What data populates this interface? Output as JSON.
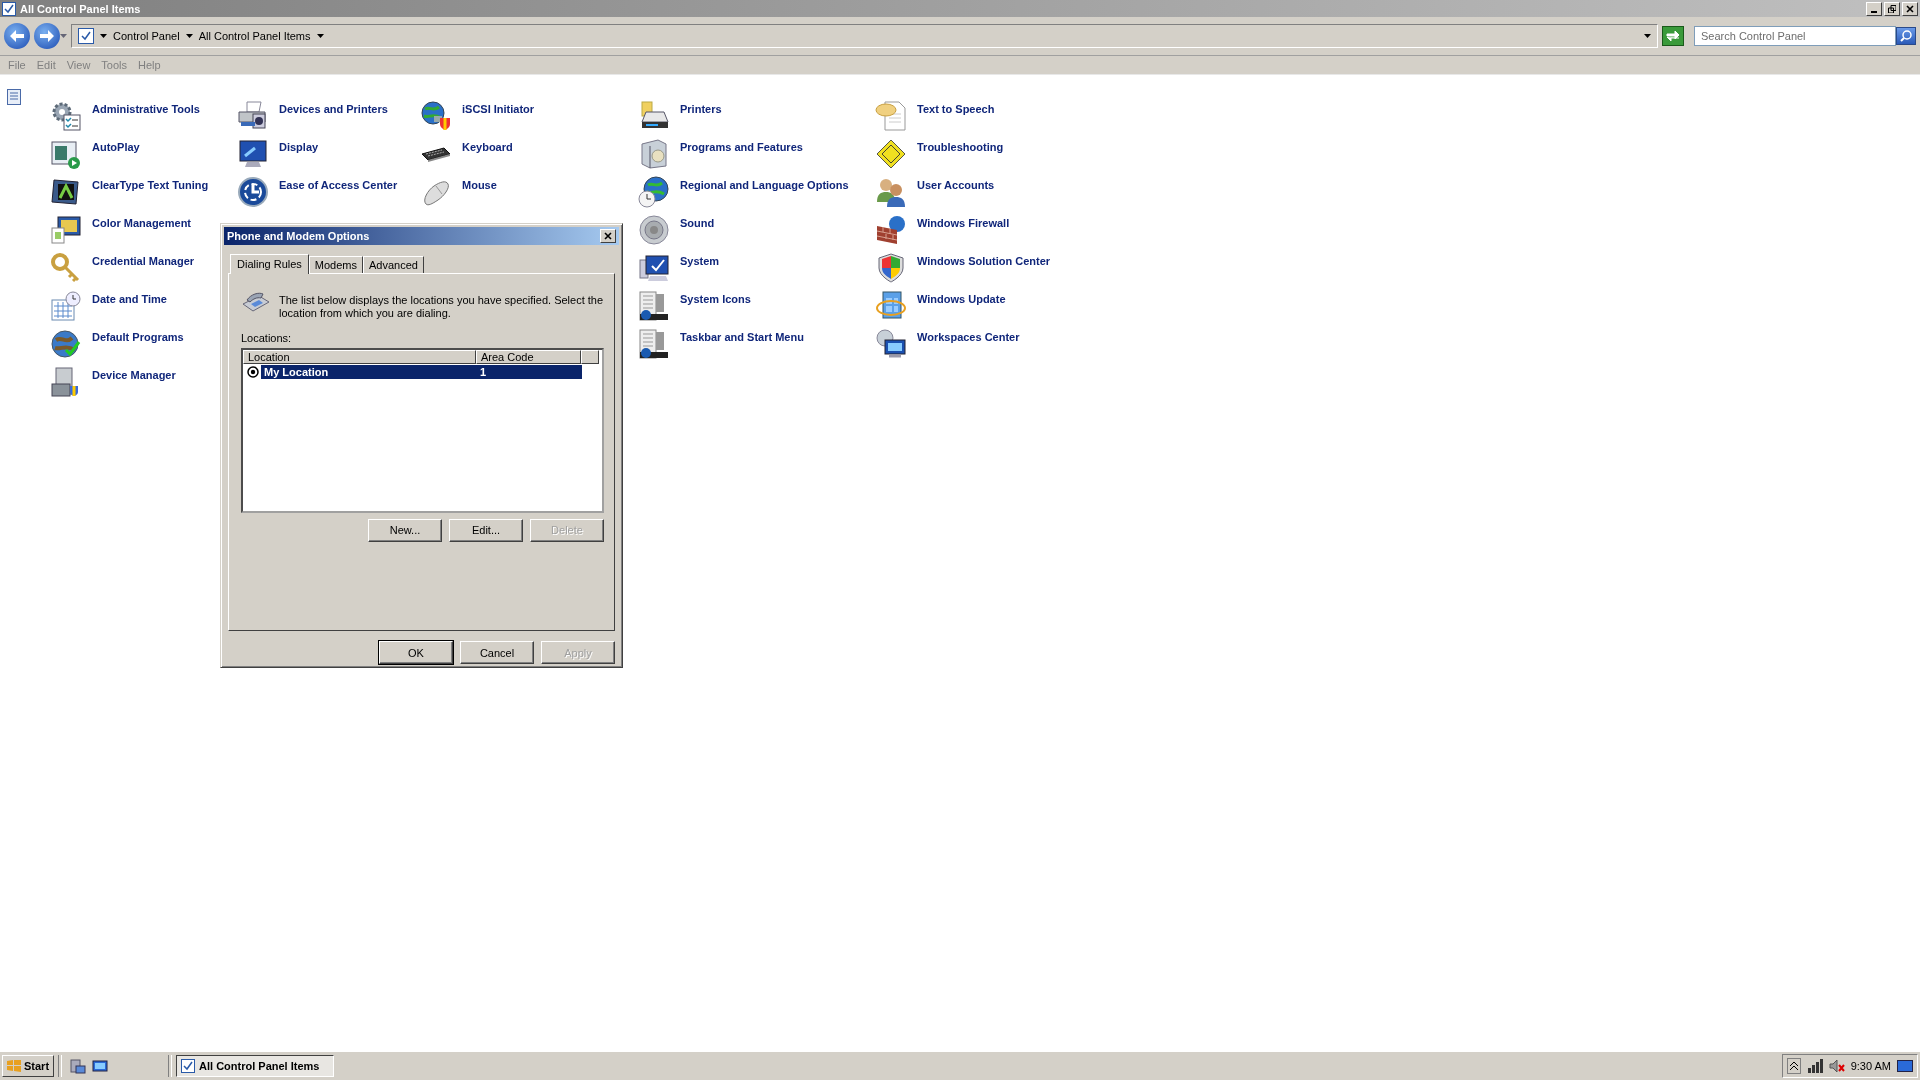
{
  "window": {
    "title": "All Control Panel Items"
  },
  "address": {
    "breadcrumbs": [
      {
        "label": "Control Panel"
      },
      {
        "label": "All Control Panel Items"
      }
    ],
    "search": {
      "placeholder": "Search Control Panel"
    }
  },
  "menu": [
    {
      "label": "File"
    },
    {
      "label": "Edit"
    },
    {
      "label": "View"
    },
    {
      "label": "Tools"
    },
    {
      "label": "Help"
    }
  ],
  "item_columns": [
    {
      "items": [
        {
          "label": "Administrative Tools"
        },
        {
          "label": "AutoPlay"
        },
        {
          "label": "ClearType Text Tuning"
        },
        {
          "label": "Color Management"
        },
        {
          "label": "Credential Manager"
        },
        {
          "label": "Date and Time"
        },
        {
          "label": "Default Programs"
        },
        {
          "label": "Device Manager"
        }
      ]
    },
    {
      "items": [
        {
          "label": "Devices and Printers"
        },
        {
          "label": "Display"
        },
        {
          "label": "Ease of Access Center"
        }
      ]
    },
    {
      "items": [
        {
          "label": "iSCSI Initiator"
        },
        {
          "label": "Keyboard"
        },
        {
          "label": "Mouse"
        }
      ]
    },
    {
      "items": [
        {
          "label": "Printers"
        },
        {
          "label": "Programs and Features"
        },
        {
          "label": "Regional and Language Options"
        },
        {
          "label": "Sound"
        },
        {
          "label": "System"
        },
        {
          "label": "System Icons"
        },
        {
          "label": "Taskbar and Start Menu"
        }
      ]
    },
    {
      "items": [
        {
          "label": "Text to Speech"
        },
        {
          "label": "Troubleshooting"
        },
        {
          "label": "User Accounts"
        },
        {
          "label": "Windows Firewall"
        },
        {
          "label": "Windows Solution Center"
        },
        {
          "label": "Windows Update"
        },
        {
          "label": "Workspaces Center"
        }
      ]
    }
  ],
  "dialog": {
    "title": "Phone and Modem Options",
    "tabs": [
      {
        "label": "Dialing Rules",
        "selected": true
      },
      {
        "label": "Modems",
        "selected": false
      },
      {
        "label": "Advanced",
        "selected": false
      }
    ],
    "description": "The list below displays the locations you have specified. Select the location from which you are dialing.",
    "locations_label": "Locations:",
    "columns": [
      {
        "label": "Location"
      },
      {
        "label": "Area Code"
      }
    ],
    "rows": [
      {
        "location": "My Location",
        "area_code": "1",
        "selected": true,
        "current": true
      }
    ],
    "list_buttons": [
      {
        "label": "New...",
        "disabled": false
      },
      {
        "label": "Edit...",
        "disabled": false
      },
      {
        "label": "Delete",
        "disabled": true
      }
    ],
    "footer_buttons": [
      {
        "label": "OK",
        "default": true,
        "disabled": false
      },
      {
        "label": "Cancel",
        "default": false,
        "disabled": false
      },
      {
        "label": "Apply",
        "default": false,
        "disabled": true
      }
    ]
  },
  "taskbar": {
    "start": "Start",
    "tasks": [
      {
        "label": "All Control Panel Items",
        "selected": true
      }
    ],
    "clock": "9:30 AM"
  }
}
